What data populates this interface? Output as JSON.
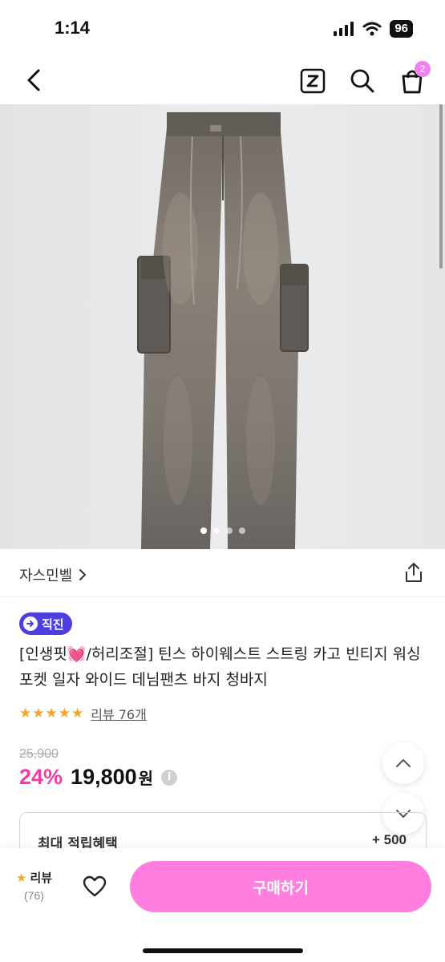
{
  "status_bar": {
    "time": "1:14",
    "battery": "96"
  },
  "nav": {
    "cart_count": "2"
  },
  "product": {
    "image_count": 4,
    "active_image": 1,
    "brand": "자스민벨",
    "badge_label": "직진",
    "title": "[인생핏💓/허리조절] 틴스 하이웨스트 스트링 카고 빈티지 워싱 포켓 일자 와이드 데님팬츠 바지 청바지",
    "rating_stars": "★★★★★",
    "review_link": "리뷰 76개",
    "original_price": "25,900",
    "discount": "24%",
    "sale_price": "19,800",
    "currency": "원",
    "info_glyph": "i"
  },
  "reward": {
    "label": "최대 적립혜택",
    "value": "+ 500"
  },
  "bottom": {
    "review_label": "리뷰",
    "review_count": "(76)",
    "buy_label": "구매하기"
  },
  "colors": {
    "accent_pink": "#ff7ee0",
    "discount_pink": "#f43ca4",
    "badge_purple": "#4f3fe0",
    "star": "#f5a623"
  }
}
